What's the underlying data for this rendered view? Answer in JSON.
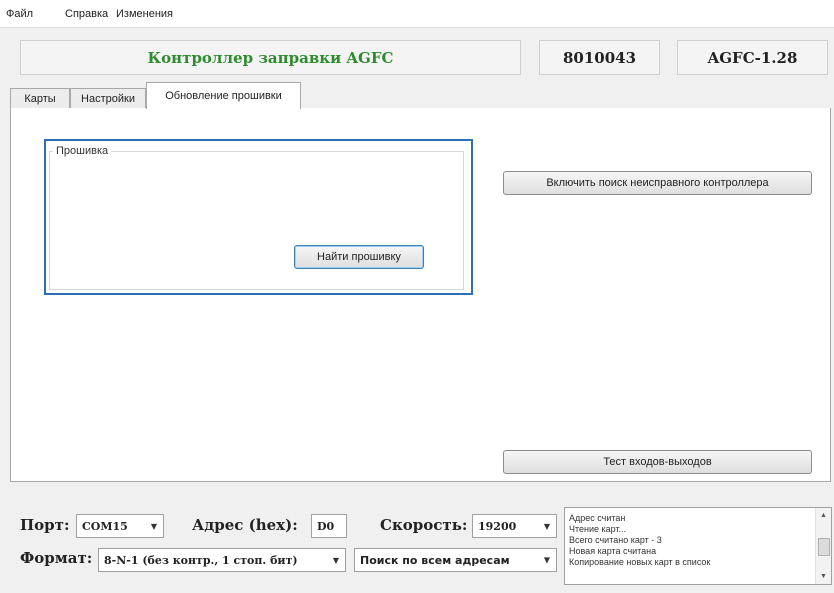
{
  "menu": {
    "items": [
      "Файл",
      "Справка",
      "Изменения"
    ]
  },
  "header": {
    "title": "Контроллер заправки AGFC",
    "serial": "8010043",
    "version": "AGFC-1.28"
  },
  "tabs": {
    "cards": "Карты",
    "settings": "Настройки",
    "firmware": "Обновление прошивки"
  },
  "firmware": {
    "group_title": "Прошивка",
    "find_button": "Найти прошивку",
    "search_controller_button": "Включить поиск неисправного контроллера",
    "io_test_button": "Тест входов-выходов"
  },
  "bottom": {
    "port_label": "Порт:",
    "port_value": "COM15",
    "address_label": "Адрес (hex):",
    "address_value": "D0",
    "speed_label": "Скорость:",
    "speed_value": "19200",
    "format_label": "Формат:",
    "format_value": "8-N-1 (без контр., 1 стоп. бит)",
    "search_mode_value": "Поиск по всем адресам"
  },
  "log": {
    "lines": [
      "Адрес считан",
      "Чтение карт...",
      "Всего считано карт - 3",
      "Новая карта считана",
      "Копирование новых карт в список"
    ]
  },
  "colors": {
    "title_green": "#2e8b2e",
    "focus_blue": "#2f6fb3"
  }
}
